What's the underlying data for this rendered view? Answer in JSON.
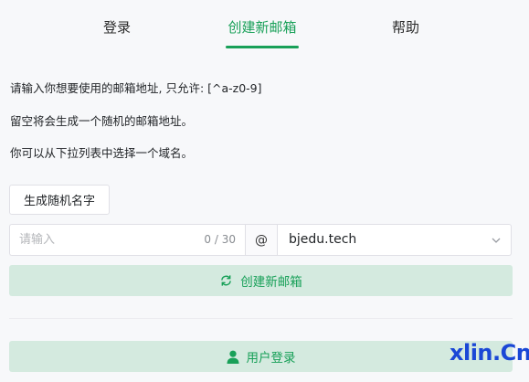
{
  "tabs": [
    {
      "label": "登录",
      "active": false
    },
    {
      "label": "创建新邮箱",
      "active": true
    },
    {
      "label": "帮助",
      "active": false
    }
  ],
  "info": {
    "line1": "请输入你想要使用的邮箱地址, 只允许: [^a-z0-9]",
    "line2": "留空将会生成一个随机的邮箱地址。",
    "line3": "你可以从下拉列表中选择一个域名。"
  },
  "random_button": {
    "label": "生成随机名字"
  },
  "address_input": {
    "value": "",
    "placeholder": "请输入",
    "counter": "0 / 30"
  },
  "at_symbol": "@",
  "domain_select": {
    "value": "bjedu.tech"
  },
  "create_button": {
    "label": "创建新邮箱",
    "icon": "refresh-icon"
  },
  "login_button": {
    "label": "用户登录",
    "icon": "user-icon"
  },
  "watermark": "xlin.Cn",
  "colors": {
    "accent": "#18a058",
    "accent_bg": "#d4eadf",
    "watermark": "#1a47d6"
  }
}
